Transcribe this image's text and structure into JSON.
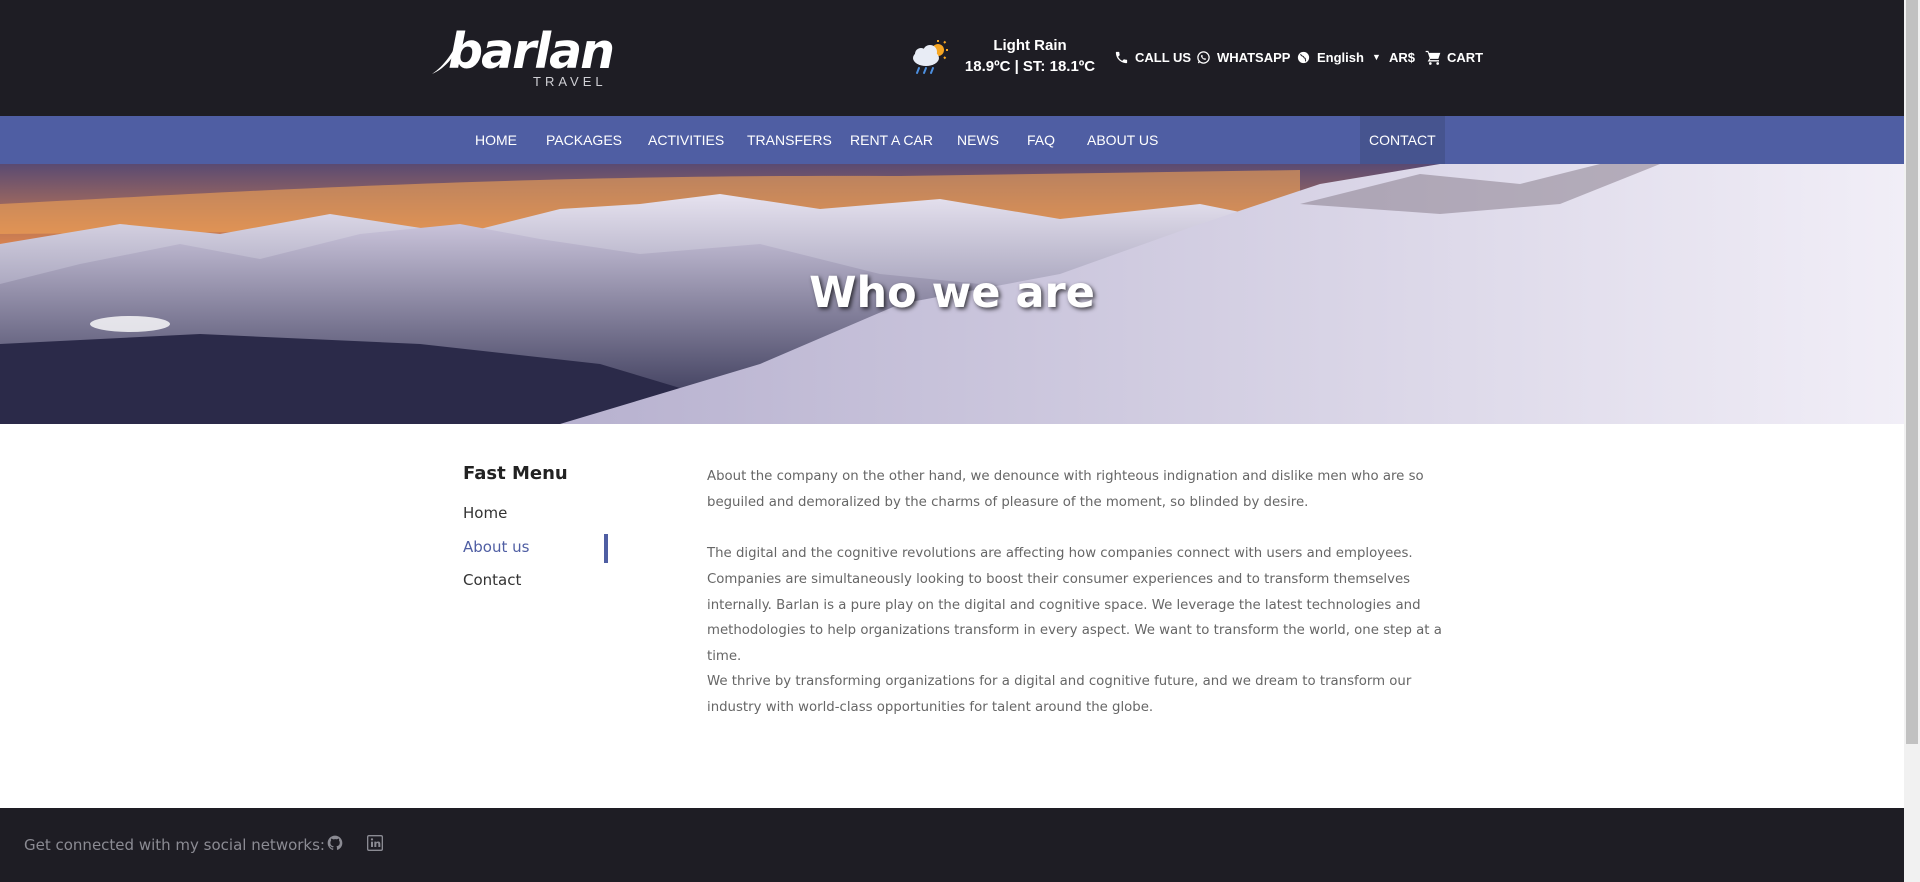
{
  "brand": {
    "name": "barlan",
    "tagline": "TRAVEL"
  },
  "weather": {
    "condition": "Light Rain",
    "temperature": "18.9ºC | ST: 18.1ºC"
  },
  "utilities": {
    "call": "CALL US",
    "whatsapp": "WHATSAPP",
    "language": "English",
    "currency": "AR$",
    "cart": "CART"
  },
  "nav": {
    "items": [
      "HOME",
      "PACKAGES",
      "ACTIVITIES",
      "TRANSFERS",
      "RENT A CAR",
      "NEWS",
      "FAQ",
      "ABOUT US"
    ],
    "contact": "CONTACT"
  },
  "hero": {
    "title": "Who we are"
  },
  "fast_menu": {
    "title": "Fast Menu",
    "items": [
      "Home",
      "About us",
      "Contact"
    ],
    "active": "About us"
  },
  "content": {
    "paragraphs": [
      "About the company on the other hand, we denounce with righteous indignation and dislike men who are so beguiled and demoralized by the charms of pleasure of the moment, so blinded by desire.",
      "The digital and the cognitive revolutions are affecting how companies connect with users and employees. Companies are simultaneously looking to boost their consumer experiences and to transform themselves internally. Barlan is a pure play on the digital and cognitive space. We leverage the latest technologies and methodologies to help organizations transform in every aspect. We want to transform the world, one step at a time.",
      "We thrive by transforming organizations for a digital and cognitive future, and we dream to transform our industry with world-class opportunities for talent around the globe."
    ]
  },
  "footer": {
    "text": "Get connected with my social networks:",
    "icons": [
      "github-icon",
      "linkedin-icon"
    ]
  },
  "colors": {
    "header_bg": "#1e1d24",
    "nav_bg": "#4f5ea3",
    "accent": "#4f5ea3"
  }
}
